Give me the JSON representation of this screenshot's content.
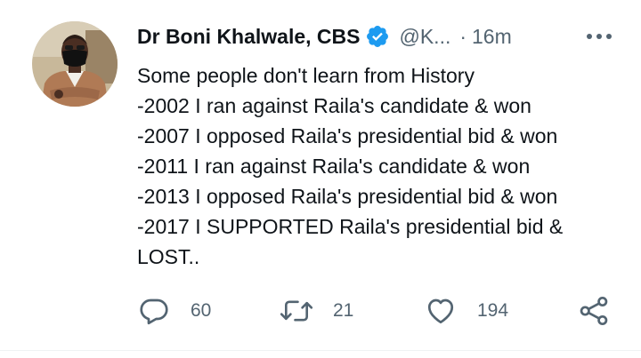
{
  "tweet": {
    "author": {
      "display_name": "Dr Boni Khalwale, CBS",
      "handle": "@K...",
      "verified": true,
      "avatar_icon": "profile-photo"
    },
    "separator": "·",
    "timestamp": "16m",
    "more_icon": "more-horizontal-icon",
    "text_lines": [
      "Some people don't learn from History",
      "-2002 I ran against Raila's candidate & won",
      "-2007 I opposed Raila's presidential bid & won",
      "-2011 I ran against Raila's candidate & won",
      "-2013 I opposed Raila's presidential bid & won",
      "-2017 I SUPPORTED Raila's presidential bid &",
      "LOST.."
    ],
    "actions": {
      "reply": {
        "icon": "reply-icon",
        "count": "60"
      },
      "retweet": {
        "icon": "retweet-icon",
        "count": "21"
      },
      "like": {
        "icon": "heart-icon",
        "count": "194"
      },
      "share": {
        "icon": "share-icon"
      }
    }
  },
  "colors": {
    "text_primary": "#0f1419",
    "text_secondary": "#536471",
    "verified_blue": "#1d9bf0",
    "divider": "#eff3f4"
  }
}
